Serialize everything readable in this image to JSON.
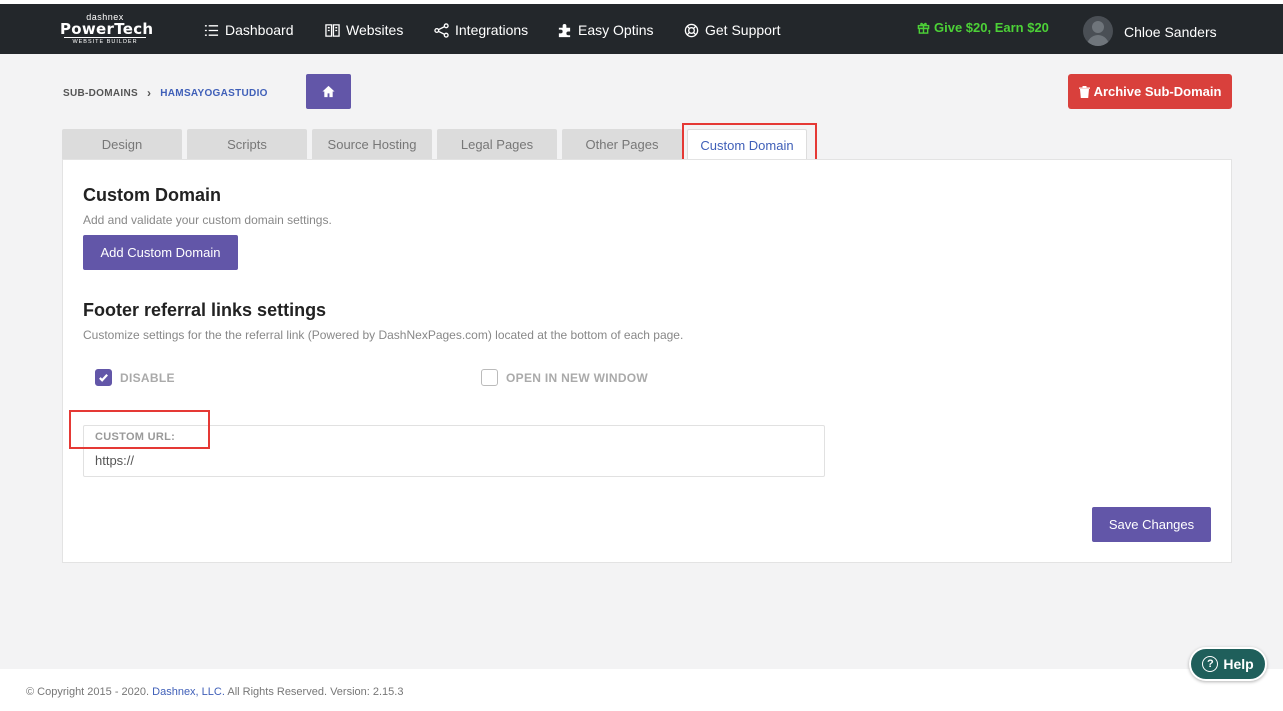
{
  "logo": {
    "line1": "dashnex",
    "line2": "PowerTech",
    "line3": "WEBSITE BUILDER"
  },
  "nav": {
    "dashboard": "Dashboard",
    "websites": "Websites",
    "integrations": "Integrations",
    "easy_optins": "Easy Optins",
    "get_support": "Get Support"
  },
  "promo": "Give $20, Earn $20",
  "user": {
    "name": "Chloe Sanders"
  },
  "breadcrumb": {
    "root": "SUB-DOMAINS",
    "separator": "›",
    "current": "HAMSAYOGASTUDIO"
  },
  "archive_label": "Archive Sub-Domain",
  "tabs": [
    {
      "label": "Design"
    },
    {
      "label": "Scripts"
    },
    {
      "label": "Source Hosting"
    },
    {
      "label": "Legal Pages"
    },
    {
      "label": "Other Pages"
    },
    {
      "label": "Custom Domain"
    }
  ],
  "custom_domain": {
    "title": "Custom Domain",
    "description": "Add and validate your custom domain settings.",
    "add_button": "Add Custom Domain"
  },
  "footer_settings": {
    "title": "Footer referral links settings",
    "description": "Customize settings for the the referral link (Powered by DashNexPages.com) located at the bottom of each page.",
    "disable_label": "DISABLE",
    "disable_checked": true,
    "new_window_label": "OPEN IN NEW WINDOW",
    "new_window_checked": false,
    "custom_url_label": "CUSTOM URL:",
    "custom_url_value": "https://"
  },
  "save_button": "Save Changes",
  "copyright": {
    "prefix": "© Copyright 2015 - 2020.",
    "company": "Dashnex, LLC.",
    "suffix": "All Rights Reserved. Version: 2.15.3"
  },
  "help_label": "Help",
  "colors": {
    "accent": "#6256a8",
    "danger": "#d9403c",
    "link": "#3f5fb8",
    "promo": "#4cd137",
    "highlight": "#e53935"
  }
}
